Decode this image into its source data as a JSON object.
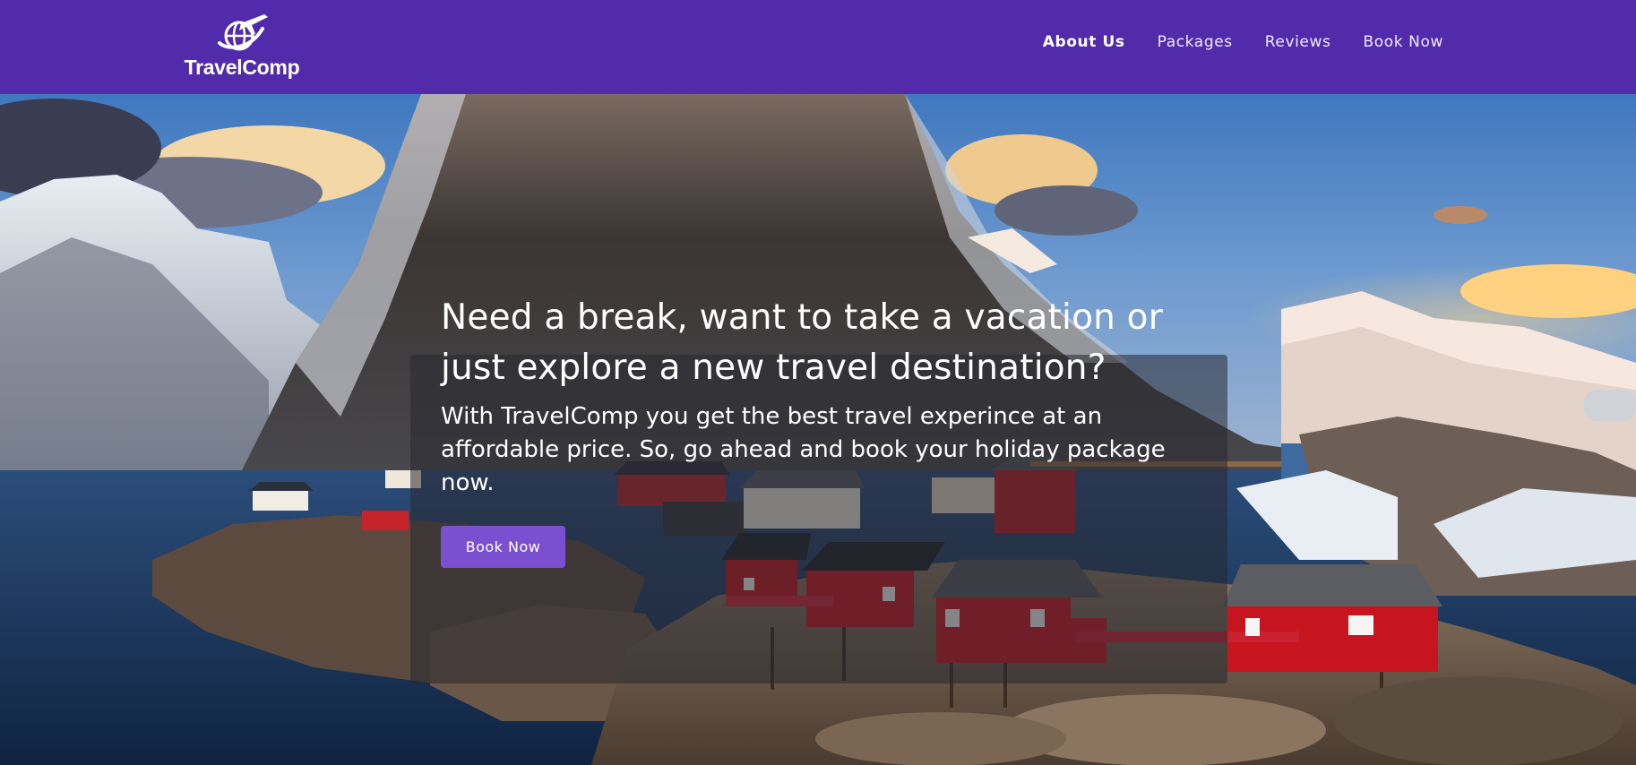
{
  "brand": {
    "name": "TravelComp",
    "logo_icon": "globe-airplane-icon",
    "color": "#522bab"
  },
  "nav": {
    "items": [
      {
        "label": "About Us",
        "active": true
      },
      {
        "label": "Packages",
        "active": false
      },
      {
        "label": "Reviews",
        "active": false
      },
      {
        "label": "Book Now",
        "active": false
      }
    ]
  },
  "hero": {
    "background": "lofoten-fishing-village-photo",
    "headline": "Need a break, want to take a vacation or just explore a new travel destination?",
    "subtext": "With TravelComp you get the best travel experince at an affordable price. So, go ahead and book your holiday package now.",
    "cta_label": "Book Now",
    "cta_color": "#7a4fd0"
  }
}
